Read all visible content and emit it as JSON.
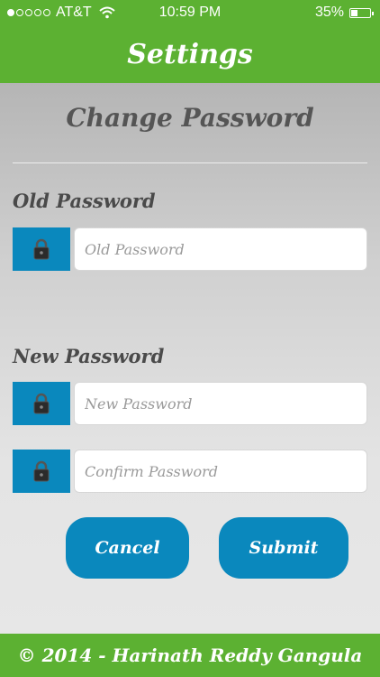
{
  "status_bar": {
    "signal_strength": 1,
    "carrier": "AT&T",
    "wifi_icon": "wifi-icon",
    "time": "10:59 PM",
    "battery_percent": "35%",
    "battery_level": 0.35
  },
  "nav": {
    "title": "Settings"
  },
  "main": {
    "title": "Change Password",
    "old_password": {
      "label": "Old Password",
      "placeholder": "Old Password",
      "icon": "lock-icon"
    },
    "new_password": {
      "label": "New Password",
      "placeholder": "New Password",
      "icon": "lock-icon"
    },
    "confirm_password": {
      "placeholder": "Confirm Password",
      "icon": "lock-icon"
    },
    "cancel_label": "Cancel",
    "submit_label": "Submit"
  },
  "footer": {
    "text": "© 2014 - Harinath Reddy Gangula"
  },
  "colors": {
    "header_green": "#5cb132",
    "accent_blue": "#0a88bd",
    "label_gray": "#4a4a4a"
  }
}
